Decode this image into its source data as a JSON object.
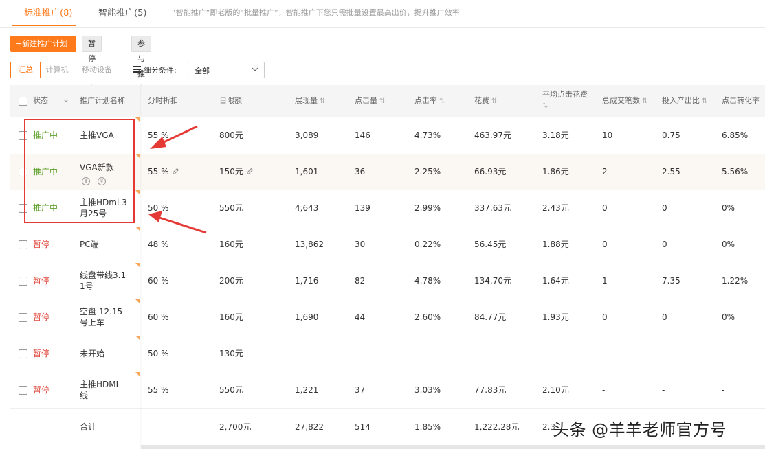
{
  "tabs": {
    "standard": "标准推广(8)",
    "smart": "智能推广(5)",
    "hint": "“智能推广”即老版的“批量推广”，智能推广下您只需批量设置最高出价，提升推广效率"
  },
  "toolbar": {
    "new_plan": "+新建推广计划",
    "pause": "暂停推广",
    "join": "参与推广"
  },
  "segments": {
    "summary": "汇总",
    "pc": "计算机",
    "mobile": "移动设备"
  },
  "filter": {
    "label": "细分条件:",
    "select_value": "全部"
  },
  "columns": {
    "status": "状态",
    "name": "推广计划名称",
    "time_discount": "分时折扣",
    "daily_limit": "日限额",
    "impressions": "展现量",
    "clicks": "点击量",
    "ctr": "点击率",
    "cost": "花费",
    "avg_cpc_1": "平均点击花费",
    "total_orders": "总成交笔数",
    "roi": "投入产出比",
    "cvr": "点击转化率"
  },
  "rows": [
    {
      "status": "推广中",
      "name1": "主推VGA",
      "name2": "",
      "discount": "55 %",
      "limit": "800元",
      "imp": "3,089",
      "clicks": "146",
      "ctr": "4.73%",
      "cost": "463.97元",
      "cpc": "3.18元",
      "orders": "10",
      "roi": "0.75",
      "cvr": "6.85%"
    },
    {
      "status": "推广中",
      "name1": "VGA新款",
      "name2": "",
      "discount": "55 %",
      "limit": "150元",
      "imp": "1,601",
      "clicks": "36",
      "ctr": "2.25%",
      "cost": "66.93元",
      "cpc": "1.86元",
      "orders": "2",
      "roi": "2.55",
      "cvr": "5.56%"
    },
    {
      "status": "推广中",
      "name1": "主推HDmi 3",
      "name2": "月25号",
      "discount": "50 %",
      "limit": "550元",
      "imp": "4,643",
      "clicks": "139",
      "ctr": "2.99%",
      "cost": "337.63元",
      "cpc": "2.43元",
      "orders": "0",
      "roi": "0",
      "cvr": "0%"
    },
    {
      "status": "暂停",
      "name1": "PC端",
      "name2": "",
      "discount": "48 %",
      "limit": "160元",
      "imp": "13,862",
      "clicks": "30",
      "ctr": "0.22%",
      "cost": "56.45元",
      "cpc": "1.88元",
      "orders": "0",
      "roi": "0",
      "cvr": "0%"
    },
    {
      "status": "暂停",
      "name1": "线盘带线3.1",
      "name2": "1号",
      "discount": "60 %",
      "limit": "200元",
      "imp": "1,716",
      "clicks": "82",
      "ctr": "4.78%",
      "cost": "134.70元",
      "cpc": "1.64元",
      "orders": "1",
      "roi": "7.35",
      "cvr": "1.22%"
    },
    {
      "status": "暂停",
      "name1": "空盘 12.15",
      "name2": "号上车",
      "discount": "60 %",
      "limit": "160元",
      "imp": "1,690",
      "clicks": "44",
      "ctr": "2.60%",
      "cost": "84.77元",
      "cpc": "1.93元",
      "orders": "0",
      "roi": "0",
      "cvr": "0%"
    },
    {
      "status": "暂停",
      "name1": "未开始",
      "name2": "",
      "discount": "50 %",
      "limit": "130元",
      "imp": "-",
      "clicks": "-",
      "ctr": "-",
      "cost": "-",
      "cpc": "-",
      "orders": "-",
      "roi": "-",
      "cvr": "-"
    },
    {
      "status": "暂停",
      "name1": "主推HDMI",
      "name2": "线",
      "discount": "55 %",
      "limit": "550元",
      "imp": "1,221",
      "clicks": "37",
      "ctr": "3.03%",
      "cost": "77.83元",
      "cpc": "2.10元",
      "orders": "-",
      "roi": "-",
      "cvr": "-"
    }
  ],
  "total": {
    "label": "合计",
    "limit": "2,700元",
    "imp": "27,822",
    "clicks": "514",
    "ctr": "1.85%",
    "cost": "1,222.28元",
    "cpc": "2.3"
  },
  "watermark": "头条 @羊羊老师官方号",
  "colors": {
    "accent": "#ff7a1a",
    "active_status": "#5ea12a",
    "paused_status": "#e0473b",
    "annotation": "#e53935"
  }
}
